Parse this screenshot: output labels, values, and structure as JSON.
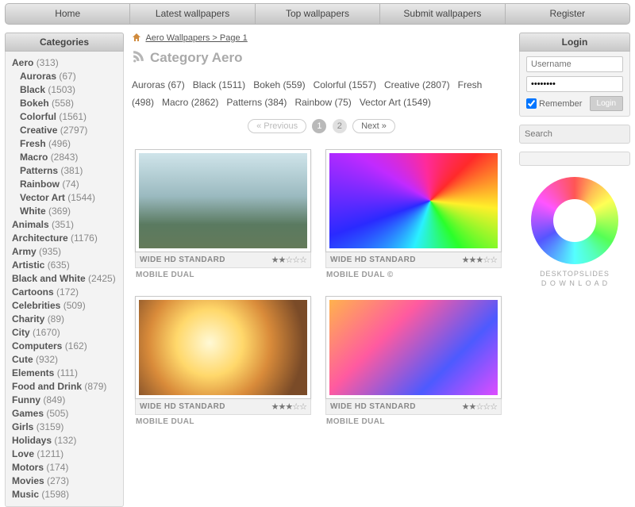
{
  "nav": [
    "Home",
    "Latest wallpapers",
    "Top wallpapers",
    "Submit wallpapers",
    "Register"
  ],
  "sidebar": {
    "title": "Categories",
    "items": [
      {
        "n": "Aero",
        "c": "(313)",
        "s": 0
      },
      {
        "n": "Auroras",
        "c": "(67)",
        "s": 1
      },
      {
        "n": "Black",
        "c": "(1503)",
        "s": 1
      },
      {
        "n": "Bokeh",
        "c": "(558)",
        "s": 1
      },
      {
        "n": "Colorful",
        "c": "(1561)",
        "s": 1
      },
      {
        "n": "Creative",
        "c": "(2797)",
        "s": 1
      },
      {
        "n": "Fresh",
        "c": "(496)",
        "s": 1
      },
      {
        "n": "Macro",
        "c": "(2843)",
        "s": 1
      },
      {
        "n": "Patterns",
        "c": "(381)",
        "s": 1
      },
      {
        "n": "Rainbow",
        "c": "(74)",
        "s": 1
      },
      {
        "n": "Vector Art",
        "c": "(1544)",
        "s": 1
      },
      {
        "n": "White",
        "c": "(369)",
        "s": 1
      },
      {
        "n": "Animals",
        "c": "(351)",
        "s": 0
      },
      {
        "n": "Architecture",
        "c": "(1176)",
        "s": 0
      },
      {
        "n": "Army",
        "c": "(935)",
        "s": 0
      },
      {
        "n": "Artistic",
        "c": "(635)",
        "s": 0
      },
      {
        "n": "Black and White",
        "c": "(2425)",
        "s": 0
      },
      {
        "n": "Cartoons",
        "c": "(172)",
        "s": 0
      },
      {
        "n": "Celebrities",
        "c": "(509)",
        "s": 0
      },
      {
        "n": "Charity",
        "c": "(89)",
        "s": 0
      },
      {
        "n": "City",
        "c": "(1670)",
        "s": 0
      },
      {
        "n": "Computers",
        "c": "(162)",
        "s": 0
      },
      {
        "n": "Cute",
        "c": "(932)",
        "s": 0
      },
      {
        "n": "Elements",
        "c": "(111)",
        "s": 0
      },
      {
        "n": "Food and Drink",
        "c": "(879)",
        "s": 0
      },
      {
        "n": "Funny",
        "c": "(849)",
        "s": 0
      },
      {
        "n": "Games",
        "c": "(505)",
        "s": 0
      },
      {
        "n": "Girls",
        "c": "(3159)",
        "s": 0
      },
      {
        "n": "Holidays",
        "c": "(132)",
        "s": 0
      },
      {
        "n": "Love",
        "c": "(1211)",
        "s": 0
      },
      {
        "n": "Motors",
        "c": "(174)",
        "s": 0
      },
      {
        "n": "Movies",
        "c": "(273)",
        "s": 0
      },
      {
        "n": "Music",
        "c": "(1598)",
        "s": 0
      }
    ]
  },
  "breadcrumb": {
    "text": "Aero Wallpapers > Page 1"
  },
  "heading": "Category Aero",
  "subcats": [
    "Auroras (67)",
    "Black (1511)",
    "Bokeh (559)",
    "Colorful (1557)",
    "Creative (2807)",
    "Fresh (498)",
    "Macro (2862)",
    "Patterns (384)",
    "Rainbow (75)",
    "Vector Art (1549)"
  ],
  "pager": {
    "prev": "« Previous",
    "pages": [
      "1",
      "2"
    ],
    "current": 0,
    "next": "Next »"
  },
  "cards": [
    {
      "meta": "WIDE HD STANDARD",
      "meta2": "MOBILE DUAL",
      "stars": 2
    },
    {
      "meta": "WIDE HD STANDARD",
      "meta2": "MOBILE DUAL ©",
      "stars": 3
    },
    {
      "meta": "WIDE HD STANDARD",
      "meta2": "MOBILE DUAL",
      "stars": 2.5
    },
    {
      "meta": "WIDE HD STANDARD",
      "meta2": "MOBILE DUAL",
      "stars": 2
    }
  ],
  "login": {
    "title": "Login",
    "user_ph": "Username",
    "pass_val": "••••••••",
    "remember": "Remember",
    "btn": "Login"
  },
  "search": {
    "placeholder": "Search"
  },
  "logo": {
    "l1": "DESKTOPSLIDES",
    "l2": "D O W N L O A D"
  }
}
